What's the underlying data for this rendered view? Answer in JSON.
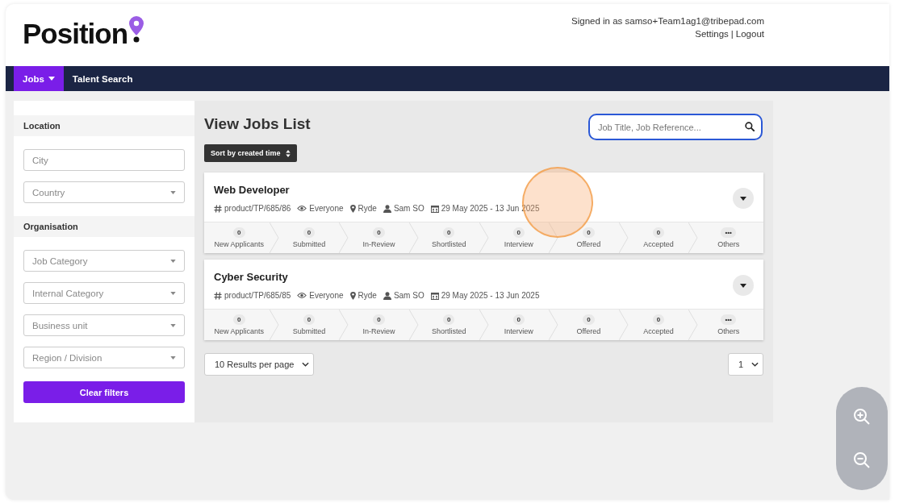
{
  "header": {
    "logo": "Position",
    "signed_in": "Signed in as samso+Team1ag1@tribepad.com",
    "links": [
      "Settings",
      "Logout"
    ],
    "separator": "|"
  },
  "nav": {
    "tabs": [
      {
        "label": "Jobs",
        "selected": true,
        "dropdown": true
      },
      {
        "label": "Talent Search",
        "selected": false,
        "dropdown": false
      }
    ]
  },
  "filters": {
    "sections": [
      {
        "title": "Location",
        "fields": [
          {
            "kind": "text",
            "placeholder": "City"
          },
          {
            "kind": "select",
            "placeholder": "Country"
          }
        ]
      },
      {
        "title": "Organisation",
        "fields": [
          {
            "kind": "select",
            "placeholder": "Job Category"
          },
          {
            "kind": "select",
            "placeholder": "Internal Category"
          },
          {
            "kind": "select",
            "placeholder": "Business unit"
          },
          {
            "kind": "select",
            "placeholder": "Region / Division"
          }
        ]
      }
    ],
    "clear_button": "Clear filters"
  },
  "main": {
    "title": "View Jobs List",
    "search": {
      "placeholder": "Job Title, Job Reference..."
    },
    "sort_button": "Sort by created time",
    "jobs": [
      {
        "title": "Web Developer",
        "meta": [
          {
            "kind": "reference",
            "text": "product/TP/685/86"
          },
          {
            "kind": "visibility",
            "text": "Everyone"
          },
          {
            "kind": "location",
            "text": "Ryde"
          },
          {
            "kind": "owner",
            "text": "Sam SO"
          },
          {
            "kind": "dates",
            "text": "29 May 2025 - 13 Jun 2025"
          }
        ],
        "stages": [
          {
            "count": "0",
            "label": "New Applicants"
          },
          {
            "count": "0",
            "label": "Submitted"
          },
          {
            "count": "0",
            "label": "In-Review"
          },
          {
            "count": "0",
            "label": "Shortlisted"
          },
          {
            "count": "0",
            "label": "Interview"
          },
          {
            "count": "0",
            "label": "Offered"
          },
          {
            "count": "0",
            "label": "Accepted"
          },
          {
            "count": "•••",
            "label": "Others"
          }
        ]
      },
      {
        "title": "Cyber Security",
        "meta": [
          {
            "kind": "reference",
            "text": "product/TP/685/85"
          },
          {
            "kind": "visibility",
            "text": "Everyone"
          },
          {
            "kind": "location",
            "text": "Ryde"
          },
          {
            "kind": "owner",
            "text": "Sam SO"
          },
          {
            "kind": "dates",
            "text": "29 May 2025 - 13 Jun 2025"
          }
        ],
        "stages": [
          {
            "count": "0",
            "label": "New Applicants"
          },
          {
            "count": "0",
            "label": "Submitted"
          },
          {
            "count": "0",
            "label": "In-Review"
          },
          {
            "count": "0",
            "label": "Shortlisted"
          },
          {
            "count": "0",
            "label": "Interview"
          },
          {
            "count": "0",
            "label": "Offered"
          },
          {
            "count": "0",
            "label": "Accepted"
          },
          {
            "count": "•••",
            "label": "Others"
          }
        ]
      }
    ],
    "per_page": "10 Results per page",
    "page": "1"
  }
}
